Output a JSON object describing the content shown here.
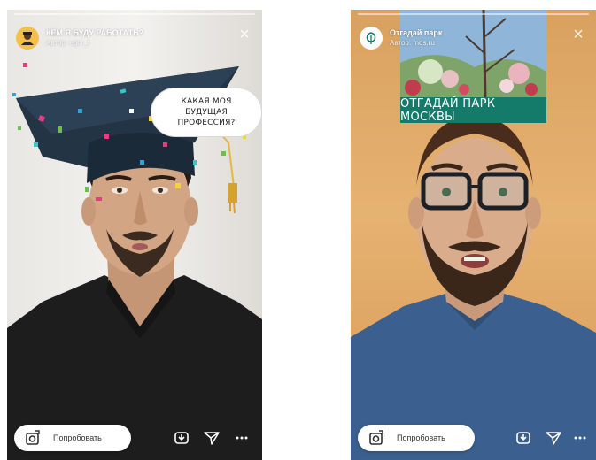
{
  "left_story": {
    "title": "КЕМ Я БУДУ РАБОТАТЬ?",
    "subtitle": "Автор: egor_t",
    "bubble_lines": [
      "Какая моя",
      "будущая",
      "профессия?"
    ],
    "try_button_label": "Попробовать",
    "icons": {
      "avatar": "user-avatar-icon",
      "close": "close-icon",
      "camera": "camera-icon",
      "save": "save-icon",
      "send": "send-icon",
      "more": "more-icon"
    }
  },
  "right_story": {
    "title": "Отгадай парк",
    "subtitle": "Автор: mos.ru",
    "banner_text": "ОТГАДАЙ ПАРК МОСКВЫ",
    "try_button_label": "Попробовать",
    "icons": {
      "avatar": "leaf-avatar-icon",
      "close": "close-icon",
      "camera": "camera-icon",
      "save": "save-icon",
      "send": "send-icon",
      "more": "more-icon"
    }
  },
  "colors": {
    "banner": "#147a69",
    "cap": "#233444",
    "shirt_left": "#1d1d1d",
    "shirt_right": "#3b5f8f"
  }
}
